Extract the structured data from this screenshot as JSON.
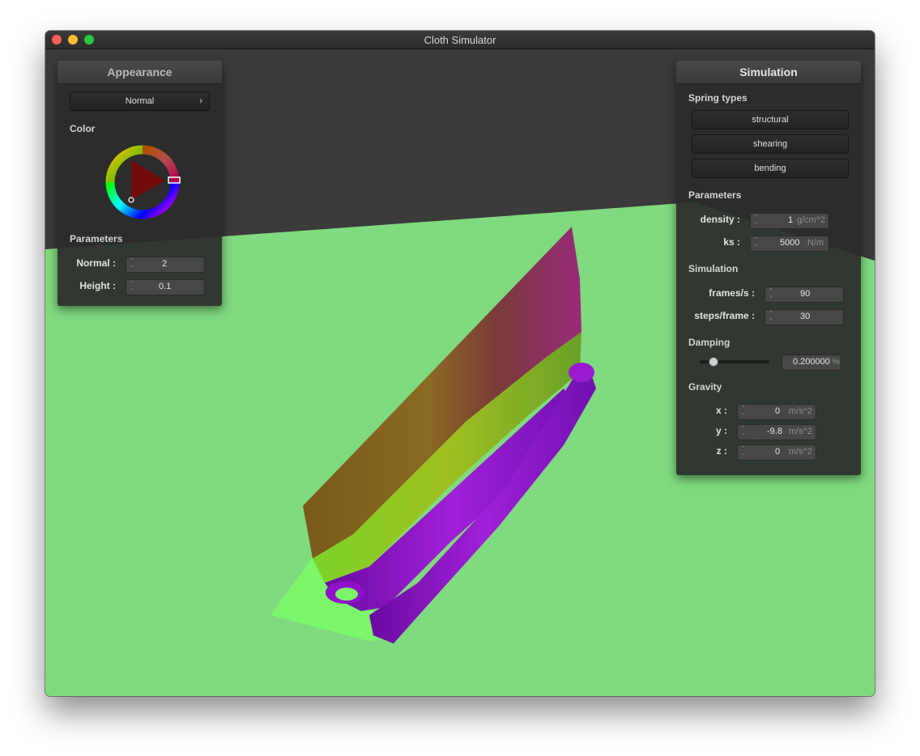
{
  "window": {
    "title": "Cloth Simulator"
  },
  "appearance": {
    "title": "Appearance",
    "shader_select": {
      "value": "Normal",
      "chevron": "›"
    },
    "color_label": "Color",
    "color_picker": {
      "hue_color": "#ff0000"
    },
    "parameters_label": "Parameters",
    "normal": {
      "label": "Normal :",
      "value": "2"
    },
    "height": {
      "label": "Height :",
      "value": "0.1"
    }
  },
  "simulation": {
    "title": "Simulation",
    "spring_types_label": "Spring types",
    "spring_buttons": [
      "structural",
      "shearing",
      "bending"
    ],
    "parameters_label": "Parameters",
    "density": {
      "label": "density :",
      "value": "1",
      "unit": "g/cm^2"
    },
    "ks": {
      "label": "ks :",
      "value": "5000",
      "unit": "N/m"
    },
    "simulation_label": "Simulation",
    "frames_per_s": {
      "label": "frames/s :",
      "value": "90"
    },
    "steps_per_frame": {
      "label": "steps/frame :",
      "value": "30"
    },
    "damping_label": "Damping",
    "damping": {
      "value": "0.200000",
      "unit": "%",
      "slider_fraction": 0.2
    },
    "gravity_label": "Gravity",
    "gravity": [
      {
        "label": "x :",
        "value": "0",
        "unit": "m/s^2"
      },
      {
        "label": "y :",
        "value": "-9.8",
        "unit": "m/s^2"
      },
      {
        "label": "z :",
        "value": "0",
        "unit": "m/s^2"
      }
    ]
  },
  "colors": {
    "floor": "#80da7f",
    "background": "#3b3b3b",
    "panel": "#2b2b2b",
    "accent_purple": "#8b10c8"
  }
}
